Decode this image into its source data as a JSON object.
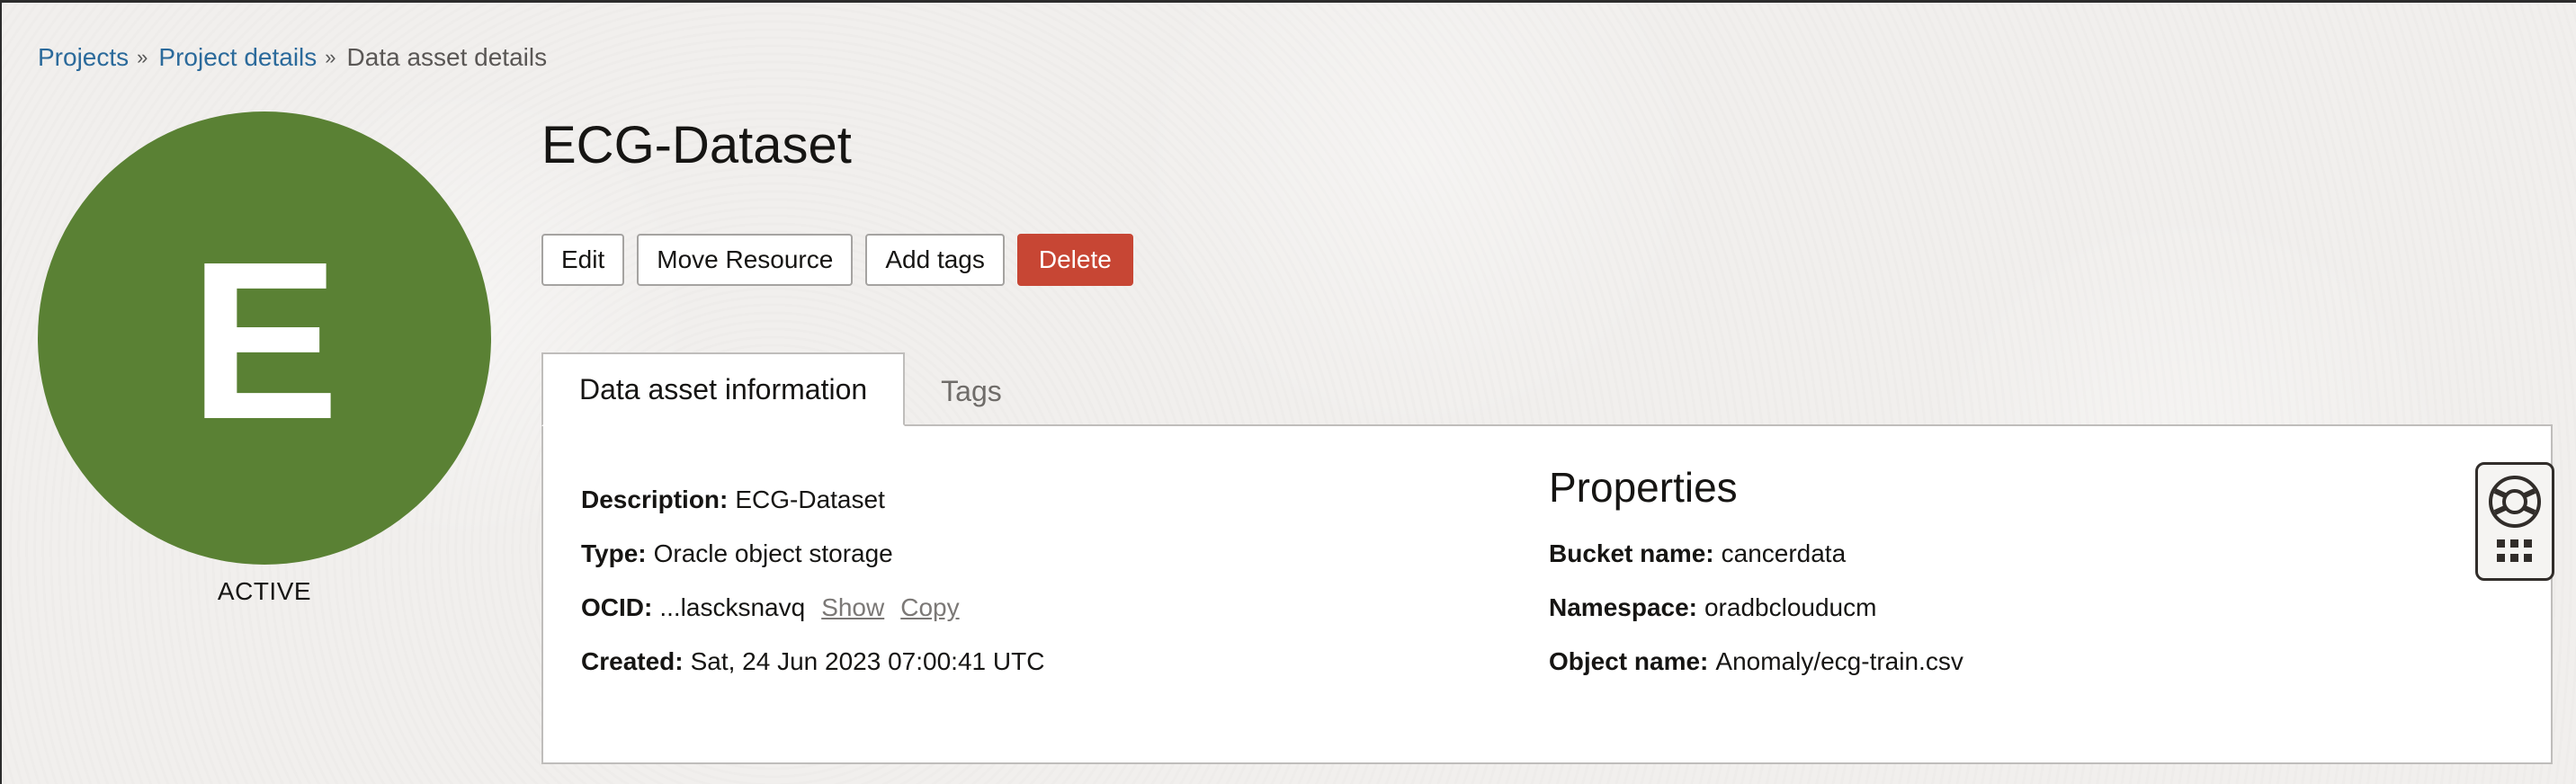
{
  "breadcrumb": {
    "items": [
      "Projects",
      "Project details"
    ],
    "current": "Data asset details",
    "separator": "»"
  },
  "avatar": {
    "letter": "E",
    "color": "#5a8134",
    "status": "ACTIVE"
  },
  "page_title": "ECG-Dataset",
  "actions": {
    "edit": "Edit",
    "move": "Move Resource",
    "add_tags": "Add tags",
    "delete": "Delete",
    "danger_color": "#c74634"
  },
  "tabs": [
    {
      "label": "Data asset information",
      "active": true
    },
    {
      "label": "Tags",
      "active": false
    }
  ],
  "info": {
    "description": {
      "label": "Description:",
      "value": "ECG-Dataset"
    },
    "type": {
      "label": "Type:",
      "value": "Oracle object storage"
    },
    "ocid": {
      "label": "OCID:",
      "value": "...lascksnavq",
      "show": "Show",
      "copy": "Copy"
    },
    "created": {
      "label": "Created:",
      "value": "Sat, 24 Jun 2023 07:00:41 UTC"
    }
  },
  "properties": {
    "title": "Properties",
    "bucket": {
      "label": "Bucket name:",
      "value": "cancerdata"
    },
    "namespace": {
      "label": "Namespace:",
      "value": "oradbclouducm"
    },
    "object": {
      "label": "Object name:",
      "value": "Anomaly/ecg-train.csv"
    }
  },
  "help_widget": {
    "icons": [
      "lifebuoy-icon",
      "grid-icon"
    ]
  },
  "colors": {
    "link": "#2b6a9b",
    "background": "#f1efed"
  }
}
